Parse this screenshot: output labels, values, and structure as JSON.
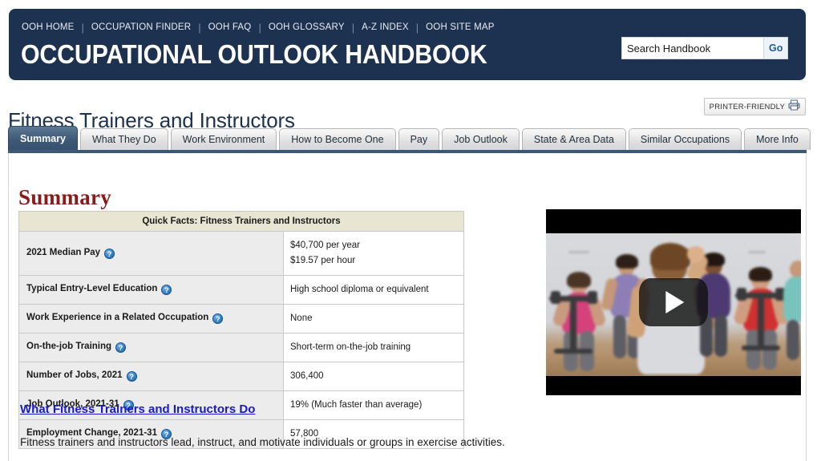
{
  "banner": {
    "site_title": "OCCUPATIONAL OUTLOOK HANDBOOK",
    "nav_links": [
      "OOH HOME",
      "OCCUPATION FINDER",
      "OOH FAQ",
      "OOH GLOSSARY",
      "A-Z INDEX",
      "OOH SITE MAP"
    ],
    "nav_separator": "|",
    "brand_color": "#1c3250"
  },
  "search": {
    "value": "Search Handbook",
    "placeholder": "Search Handbook",
    "button_label": "Go",
    "icon": "search-icon"
  },
  "page": {
    "title": "Fitness Trainers and Instructors",
    "printer_friendly_label": "PRINTER-FRIENDLY",
    "printer_icon": "printer-icon",
    "title_color": "#1c3250"
  },
  "tabs": [
    {
      "label": "Summary",
      "active": true
    },
    {
      "label": "What They Do",
      "active": false
    },
    {
      "label": "Work Environment",
      "active": false
    },
    {
      "label": "How to Become One",
      "active": false
    },
    {
      "label": "Pay",
      "active": false
    },
    {
      "label": "Job Outlook",
      "active": false
    },
    {
      "label": "State & Area Data",
      "active": false
    },
    {
      "label": "Similar Occupations",
      "active": false
    },
    {
      "label": "More Info",
      "active": false
    }
  ],
  "main": {
    "section_heading": "Summary",
    "section_heading_color": "#8b1a1a",
    "quick_facts": {
      "caption": "Quick Facts: Fitness Trainers and Instructors",
      "help_glyph": "?",
      "rows": [
        {
          "label": "2021 Median Pay",
          "help": true,
          "value_lines": [
            "$40,700 per year",
            "$19.57 per hour"
          ]
        },
        {
          "label": "Typical Entry-Level Education",
          "help": true,
          "value_lines": [
            "High school diploma or equivalent"
          ]
        },
        {
          "label": "Work Experience in a Related Occupation",
          "help": true,
          "value_lines": [
            "None"
          ]
        },
        {
          "label": "On-the-job Training",
          "help": true,
          "value_lines": [
            "Short-term on-the-job training"
          ]
        },
        {
          "label": "Number of Jobs, 2021",
          "help": true,
          "value_lines": [
            "306,400"
          ]
        },
        {
          "label": "Job Outlook, 2021-31",
          "help": true,
          "value_lines": [
            "19% (Much faster than average)"
          ]
        },
        {
          "label": "Employment Change, 2021-31",
          "help": true,
          "value_lines": [
            "57,800"
          ]
        }
      ]
    },
    "what_they_do": {
      "link_label": "What Fitness Trainers and Instructors Do",
      "link_color": "#1919c8",
      "paragraph": "Fitness trainers and instructors lead, instruct, and motivate individuals or groups in exercise activities."
    }
  },
  "video": {
    "play_icon": "play-button-icon",
    "description": "Fitness instructor leading an indoor cycling class"
  }
}
